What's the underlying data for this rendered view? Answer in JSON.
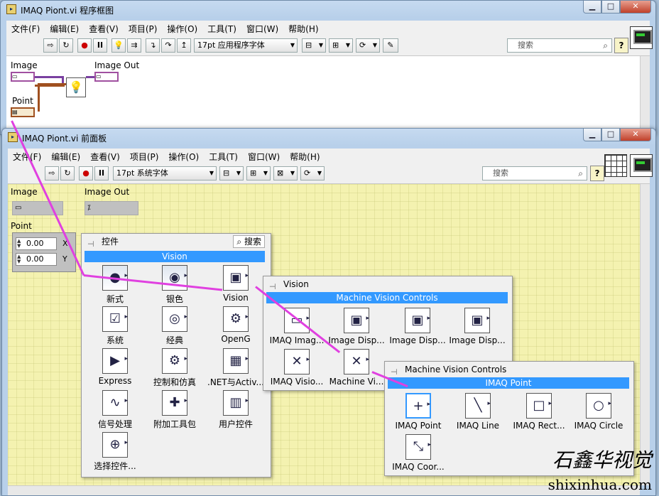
{
  "bd_window": {
    "title": "IMAQ Piont.vi 程序框图",
    "menu": [
      "文件(F)",
      "编辑(E)",
      "查看(V)",
      "项目(P)",
      "操作(O)",
      "工具(T)",
      "窗口(W)",
      "帮助(H)"
    ],
    "font_select": "17pt 应用程序字体",
    "search_placeholder": "搜索",
    "help_label": "?",
    "labels": {
      "image": "Image",
      "image_out": "Image Out",
      "point": "Point"
    }
  },
  "fp_window": {
    "title": "IMAQ Piont.vi 前面板",
    "menu": [
      "文件(F)",
      "编辑(E)",
      "查看(V)",
      "项目(P)",
      "操作(O)",
      "工具(T)",
      "窗口(W)",
      "帮助(H)"
    ],
    "font_select": "17pt 系统字体",
    "search_placeholder": "搜索",
    "help_label": "?",
    "labels": {
      "image": "Image",
      "image_out": "Image Out",
      "point": "Point"
    },
    "point_x": "0.00",
    "point_y": "0.00",
    "x_label": "X",
    "y_label": "Y"
  },
  "controls_palette": {
    "title": "控件",
    "search_label": "搜索",
    "category": "Vision",
    "items": [
      "新式",
      "银色",
      "Vision",
      "系统",
      "经典",
      "OpenG",
      "Express",
      "控制和仿真",
      ".NET与Activ...",
      "信号处理",
      "附加工具包",
      "用户控件",
      "选择控件..."
    ]
  },
  "vision_palette": {
    "title": "Vision",
    "category": "Machine Vision Controls",
    "items": [
      "IMAQ Imag...",
      "Image Disp...",
      "Image Disp...",
      "Image Disp...",
      "IMAQ Visio...",
      "Machine Vi..."
    ]
  },
  "mvc_palette": {
    "title": "Machine Vision Controls",
    "category": "IMAQ Point",
    "items": [
      "IMAQ Point",
      "IMAQ Line",
      "IMAQ Rect...",
      "IMAQ Circle",
      "IMAQ Coor..."
    ]
  },
  "watermark": {
    "site": "shixinhua.com"
  },
  "colors": {
    "accent": "#3399ff",
    "arrow": "#e040e0",
    "panel_bg": "#f4f2b0"
  }
}
